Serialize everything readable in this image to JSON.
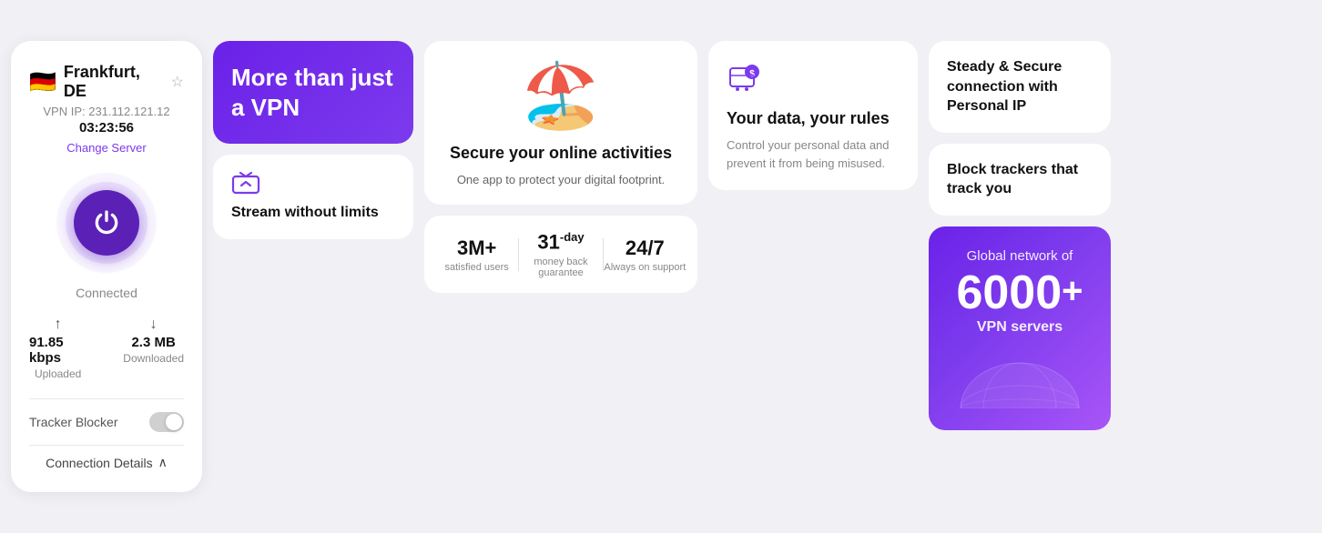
{
  "col1": {
    "more_than": {
      "title": "More than just a VPN"
    },
    "stream": {
      "label": "Stream without limits"
    }
  },
  "col2": {
    "beach": {
      "title": "Secure your online activities",
      "subtitle": "One app to protect your digital footprint."
    },
    "stats": [
      {
        "number": "3M+",
        "label": "satisfied users"
      },
      {
        "number": "31",
        "suffix": "-day",
        "label": "money back guarantee"
      },
      {
        "number": "24/7",
        "label": "Always on support"
      }
    ]
  },
  "col3": {
    "location": "Frankfurt, DE",
    "ip": "VPN IP: 231.112.121.12",
    "timer": "03:23:56",
    "change_server": "Change Server",
    "status": "Connected",
    "upload": {
      "value": "91.85 kbps",
      "label": "Uploaded"
    },
    "download": {
      "value": "2.3 MB",
      "label": "Downloaded"
    },
    "tracker_label": "Tracker Blocker",
    "conn_details": "Connection Details"
  },
  "col4": {
    "data": {
      "title": "Your data, your rules",
      "desc": "Control your personal data and prevent it from being misused."
    }
  },
  "col5": {
    "feature1": {
      "title": "Steady & Secure connection with Personal IP"
    },
    "feature2": {
      "title": "Block trackers that track you"
    },
    "network": {
      "title": "Global network of",
      "number": "6000",
      "sub": "VPN servers"
    }
  }
}
